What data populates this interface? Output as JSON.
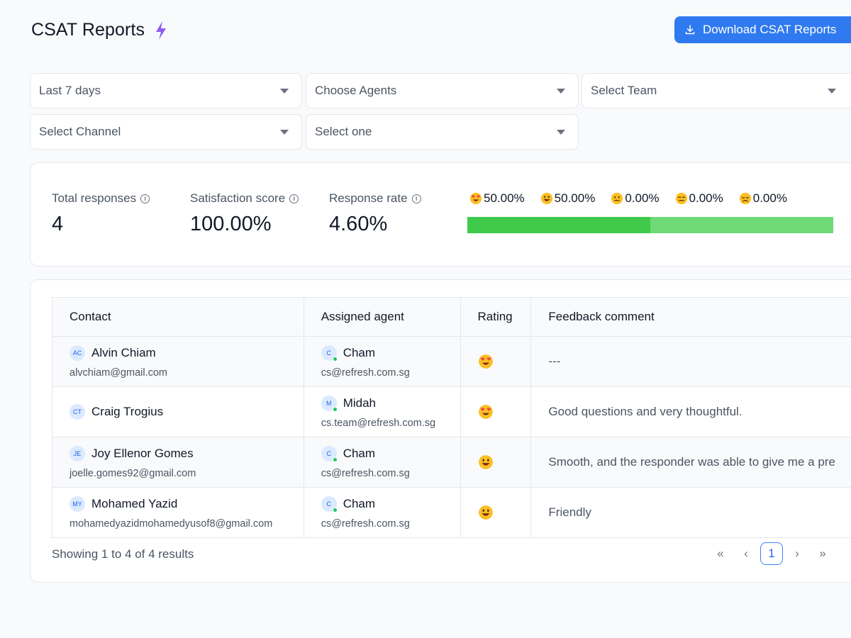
{
  "header": {
    "title": "CSAT Reports",
    "download_label": "Download CSAT Reports"
  },
  "filters": {
    "date": "Last 7 days",
    "agents": "Choose Agents",
    "team": "Select Team",
    "channel": "Select Channel",
    "other": "Select one"
  },
  "stats": {
    "total_label": "Total responses",
    "total_value": "4",
    "satisfaction_label": "Satisfaction score",
    "satisfaction_value": "100.00%",
    "rate_label": "Response rate",
    "rate_value": "4.60%"
  },
  "distribution": [
    {
      "icon": "heart-eyes-emoji-icon",
      "pct": "50.00%",
      "value": 50,
      "color": "#40ca4b"
    },
    {
      "icon": "grinning-emoji-icon",
      "pct": "50.00%",
      "value": 50,
      "color": "#6ed975"
    },
    {
      "icon": "neutral-emoji-icon",
      "pct": "0.00%",
      "value": 0,
      "color": "#f59e0b"
    },
    {
      "icon": "expressionless-emoji-icon",
      "pct": "0.00%",
      "value": 0,
      "color": "#f97316"
    },
    {
      "icon": "disappointed-emoji-icon",
      "pct": "0.00%",
      "value": 0,
      "color": "#ef4444"
    }
  ],
  "table": {
    "headers": {
      "contact": "Contact",
      "agent": "Assigned agent",
      "rating": "Rating",
      "feedback": "Feedback comment"
    },
    "rows": [
      {
        "initials": "AC",
        "name": "Alvin Chiam",
        "email": "alvchiam@gmail.com",
        "agent_initial": "C",
        "agent": "Cham",
        "agent_email": "cs@refresh.com.sg",
        "rating_icon": "heart-eyes-emoji-icon",
        "feedback": "---"
      },
      {
        "initials": "CT",
        "name": "Craig Trogius",
        "email": "",
        "agent_initial": "M",
        "agent": "Midah",
        "agent_email": "cs.team@refresh.com.sg",
        "rating_icon": "heart-eyes-emoji-icon",
        "feedback": "Good questions and very thoughtful."
      },
      {
        "initials": "JE",
        "name": "Joy Ellenor Gomes",
        "email": "joelle.gomes92@gmail.com",
        "agent_initial": "C",
        "agent": "Cham",
        "agent_email": "cs@refresh.com.sg",
        "rating_icon": "grinning-emoji-icon",
        "feedback": "Smooth, and the responder was able to give me a pre"
      },
      {
        "initials": "MY",
        "name": "Mohamed Yazid",
        "email": "mohamedyazidmohamedyusof8@gmail.com",
        "agent_initial": "C",
        "agent": "Cham",
        "agent_email": "cs@refresh.com.sg",
        "rating_icon": "grinning-emoji-icon",
        "feedback": "Friendly"
      }
    ]
  },
  "pagination": {
    "results_text": "Showing 1 to 4 of 4 results",
    "first": "«",
    "prev": "‹",
    "page": "1",
    "next": "›",
    "last": "»"
  }
}
